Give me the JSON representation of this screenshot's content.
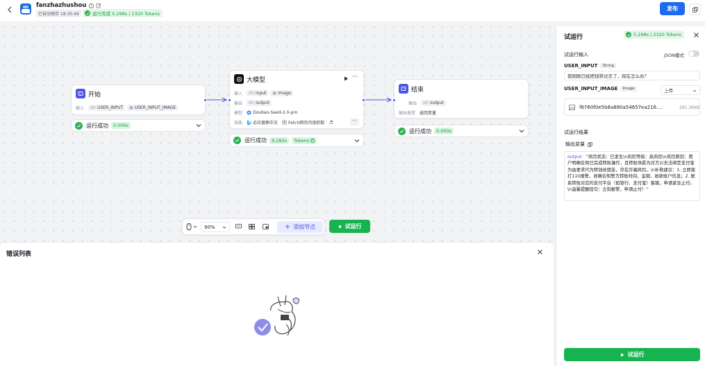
{
  "topbar": {
    "app_name": "fanzhazhushou",
    "autosave": "已自动保存 18:30:49",
    "run_status": "运行完成 5.298s | 2320 Tokens",
    "publish_label": "发布"
  },
  "nodes": {
    "start": {
      "title": "开始",
      "input_label": "输入",
      "var1": "USER_INPUT",
      "var1_type": "str",
      "var2": "USER_INPUT_IMAGE",
      "status": "运行成功",
      "time": "0.000s"
    },
    "llm": {
      "title": "大模型",
      "input_label": "输入",
      "in1": "input",
      "in1_type": "str",
      "in2": "image",
      "output_label": "输出",
      "out1": "output",
      "out1_type": "str",
      "model_label": "模型",
      "model": "Doubao-Seed-2.0-pro",
      "skills_label": "技能",
      "skill1": "必应搜索中文",
      "skill2": "Fetch网页内容抓取",
      "status": "运行成功",
      "time": "9.282s",
      "tokens_label": "Tokens"
    },
    "end": {
      "title": "结束",
      "output_label": "输出",
      "out1": "output",
      "out1_type": "str",
      "content_label": "输出类型",
      "content_value": "返回变量",
      "status": "运行成功",
      "time": "0.000s"
    }
  },
  "toolbar": {
    "zoom": "90%",
    "add_node_label": "添加节点",
    "test_run_label": "试运行"
  },
  "error_panel": {
    "title": "错误列表"
  },
  "right_panel": {
    "title": "试运行",
    "status": "5.298s | 2320 Tokens",
    "input_section": "试运行输入",
    "json_mode_label": "JSON模式",
    "field1_name": "USER_INPUT",
    "field1_type": "String",
    "field1_value": "我刚刚已经把钱转过去了，现在怎么办？",
    "field2_name": "USER_INPUT_IMAGE",
    "field2_type": "Image",
    "upload_label": "上传",
    "file_name": "f6760f0e5b8a880a54657ea216....",
    "file_size": "261.36KB",
    "result_section": "试运行结果",
    "output_var_label": "输出变量",
    "output_key": "output",
    "output_text": "\"风险状态：已发生\\n风险等级：高风险\\n风险原因：用户明确告知已完成转账操作，且转账场景为对方以无法绑定支付宝为由要求代为转钱给朋友，存在诈骗风险。\\n补救建议：1. 立即拨打110报警，准确告知警方转账时间、金额、收款账户信息；2. 联系转账对应的支付平台（如银行、支付宝）客服，申请紧急止付。\\n温馨提醒短句：立刻报警，申请止付！\"",
    "bottom_run_label": "试运行"
  }
}
